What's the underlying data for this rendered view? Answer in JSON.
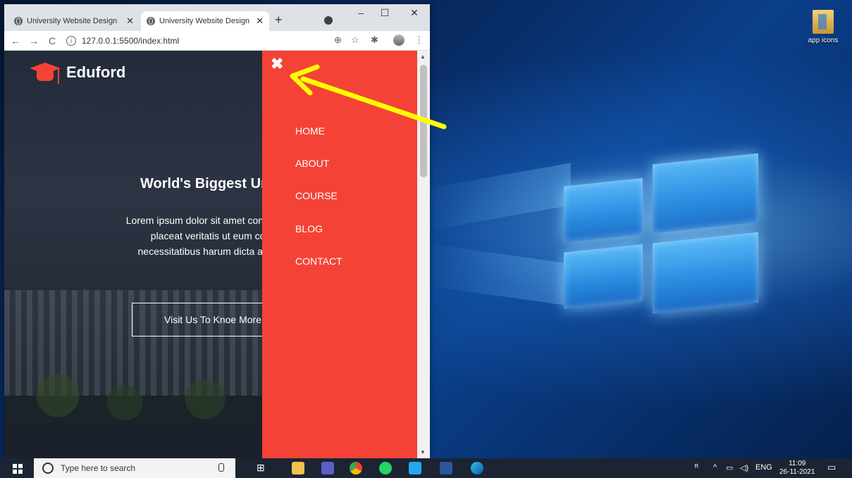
{
  "browser": {
    "tabs": [
      {
        "title": "University Website Design",
        "active": false
      },
      {
        "title": "University Website Design",
        "active": true
      }
    ],
    "new_tab": "+",
    "url": "127.0.0.1:5500/index.html",
    "window_controls": {
      "minimize": "–",
      "maximize": "☐",
      "close": "✕"
    }
  },
  "page": {
    "brand": "Eduford",
    "hero_title": "World's Biggest Univ",
    "hero_text_lines": [
      "Lorem ipsum dolor sit amet consectetu",
      "placeat veritatis ut eum con",
      "necessitatibus harum dicta ab inc"
    ],
    "hero_button": "Visit Us To Knoe More",
    "menu": {
      "close": "✖",
      "items": [
        "HOME",
        "ABOUT",
        "COURSE",
        "BLOG",
        "CONTACT"
      ]
    }
  },
  "desktop": {
    "icon_label": "app icons"
  },
  "taskbar": {
    "search_placeholder": "Type here to search",
    "language": "ENG",
    "time": "11:09",
    "date": "26-11-2021"
  },
  "colors": {
    "menu_bg": "#f44336",
    "arrow": "#ffff00",
    "taskbar": "#1c2433"
  }
}
